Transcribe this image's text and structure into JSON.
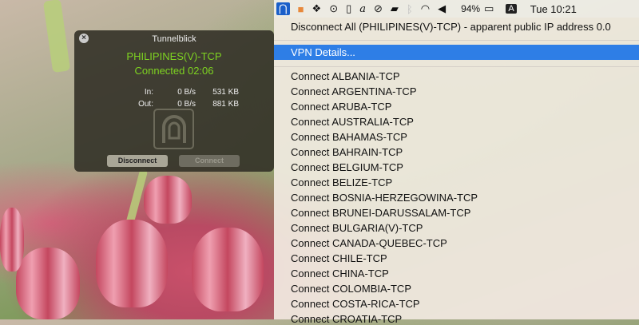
{
  "window": {
    "title": "Tunnelblick",
    "vpn_name": "PHILIPINES(V)-TCP",
    "status": "Connected 02:06",
    "in_label": "In:",
    "in_rate": "0 B/s",
    "in_total": "531 KB",
    "out_label": "Out:",
    "out_rate": "0 B/s",
    "out_total": "881 KB",
    "disconnect_label": "Disconnect",
    "connect_label": "Connect",
    "close_glyph": "×"
  },
  "menubar": {
    "battery": "94%",
    "input_source": "A",
    "clock": "Tue 10:21"
  },
  "menu": {
    "disconnect_all": "Disconnect All (PHILIPINES(V)-TCP) - apparent public IP address 0.0",
    "vpn_details": "VPN Details...",
    "items": [
      "Connect ALBANIA-TCP",
      "Connect ARGENTINA-TCP",
      "Connect ARUBA-TCP",
      "Connect AUSTRALIA-TCP",
      "Connect BAHAMAS-TCP",
      "Connect BAHRAIN-TCP",
      "Connect BELGIUM-TCP",
      "Connect BELIZE-TCP",
      "Connect BOSNIA-HERZEGOWINA-TCP",
      "Connect BRUNEI-DARUSSALAM-TCP",
      "Connect BULGARIA(V)-TCP",
      "Connect CANADA-QUEBEC-TCP",
      "Connect CHILE-TCP",
      "Connect CHINA-TCP",
      "Connect COLOMBIA-TCP",
      "Connect COSTA-RICA-TCP",
      "Connect CROATIA-TCP"
    ]
  },
  "colors": {
    "accent": "#2e7ee6",
    "connected": "#7ed321"
  }
}
